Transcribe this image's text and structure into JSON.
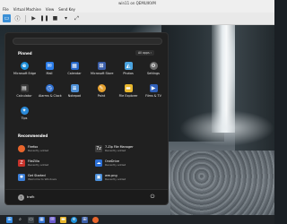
{
  "window": {
    "title": "win11 on QEMU/KVM",
    "menu": [
      "File",
      "Virtual Machine",
      "View",
      "Send Key"
    ]
  },
  "toolbar": [
    "monitor-icon",
    "info-icon",
    "play-icon",
    "pause-icon",
    "stop-icon",
    "snapshot-icon",
    "fullscreen-icon"
  ],
  "start_menu": {
    "pinned_title": "Pinned",
    "all_apps_label": "All apps  ›",
    "pinned": [
      {
        "label": "Microsoft Edge",
        "icon": "edge-icon",
        "color": "#1e8fd8"
      },
      {
        "label": "Mail",
        "icon": "mail-icon",
        "color": "#2b7de9"
      },
      {
        "label": "Calendar",
        "icon": "calendar-icon",
        "color": "#2667c9"
      },
      {
        "label": "Microsoft Store",
        "icon": "store-icon",
        "color": "#3b5ea8"
      },
      {
        "label": "Photos",
        "icon": "photos-icon",
        "color": "#4aa3df"
      },
      {
        "label": "Settings",
        "icon": "gear-icon",
        "color": "#6b6b6b"
      },
      {
        "label": "Calculator",
        "icon": "calculator-icon",
        "color": "#3a3a3a"
      },
      {
        "label": "Alarms & Clock",
        "icon": "clock-icon",
        "color": "#2f6fd0"
      },
      {
        "label": "Notepad",
        "icon": "notepad-icon",
        "color": "#4d8fd6"
      },
      {
        "label": "Paint",
        "icon": "paint-icon",
        "color": "#e6a12e"
      },
      {
        "label": "File Explorer",
        "icon": "folder-icon",
        "color": "#e8b62c"
      },
      {
        "label": "Films & TV",
        "icon": "film-icon",
        "color": "#2f5fb8"
      },
      {
        "label": "Tips",
        "icon": "tips-icon",
        "color": "#2a8ad9"
      }
    ],
    "recommended_title": "Recommended",
    "recommended": [
      {
        "name": "Firefox",
        "sub": "Recently added",
        "icon": "firefox-icon",
        "color": "#e8652c"
      },
      {
        "name": "7-Zip File Manager",
        "sub": "Recently added",
        "icon": "7zip-icon",
        "color": "#3d3d3d"
      },
      {
        "name": "FileZilla",
        "sub": "Recently added",
        "icon": "filezilla-icon",
        "color": "#c7322b"
      },
      {
        "name": "OneDrive",
        "sub": "Recently added",
        "icon": "onedrive-icon",
        "color": "#2b6fd6"
      },
      {
        "name": "Get Started",
        "sub": "Welcome to Windows",
        "icon": "get-started-icon",
        "color": "#3c7fd8"
      },
      {
        "name": "wm.png",
        "sub": "Recently added",
        "icon": "image-file-icon",
        "color": "#4b8fda"
      }
    ],
    "user": {
      "name": "trafk",
      "avatar_letter": "t"
    }
  },
  "taskbar": [
    "windows-start-icon",
    "search-icon",
    "task-view-icon",
    "widgets-icon",
    "chat-icon",
    "file-explorer-icon",
    "edge-icon",
    "store-icon",
    "firefox-icon"
  ]
}
